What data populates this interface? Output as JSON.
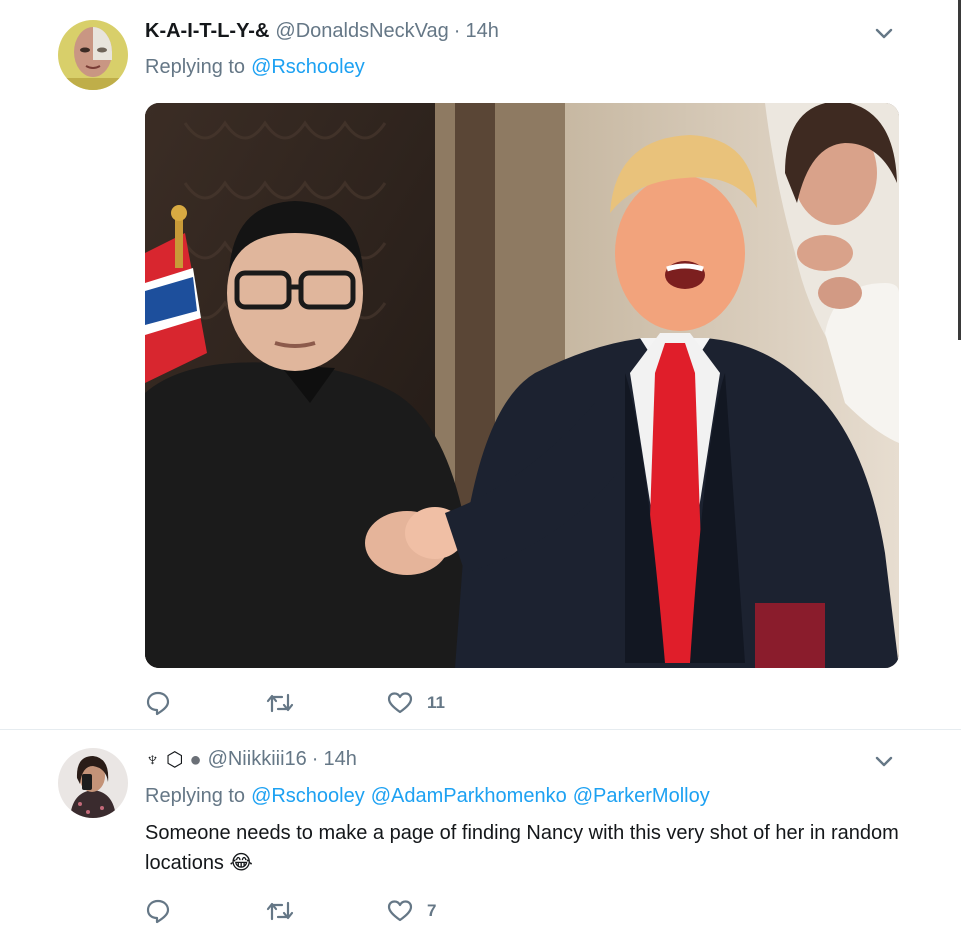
{
  "tweets": [
    {
      "display_name": "K-A-I-T-L-Y-&",
      "handle": "@DonaldsNeckVag",
      "separator": "·",
      "time": "14h",
      "replying_label": "Replying to",
      "mentions": [
        "@Rschooley"
      ],
      "text": "",
      "like_count": "11",
      "has_media": true
    },
    {
      "display_name_icons": [
        "♆",
        "⬡",
        "●"
      ],
      "handle": "@Niikkiii16",
      "separator": "·",
      "time": "14h",
      "replying_label": "Replying to",
      "mentions": [
        "@Rschooley",
        "@AdamParkhomenko",
        "@ParkerMolloy"
      ],
      "text": "Someone needs to make a page of finding Nancy with this very shot of her in random locations",
      "text_emoji": "😂",
      "like_count": "7",
      "has_media": false
    }
  ],
  "colors": {
    "link": "#1da1f2",
    "muted": "#657786",
    "text": "#14171a",
    "divider": "#e6ecf0"
  },
  "icons": {
    "reply": "reply-icon",
    "retweet": "retweet-icon",
    "like": "heart-icon",
    "more": "chevron-down-icon"
  }
}
